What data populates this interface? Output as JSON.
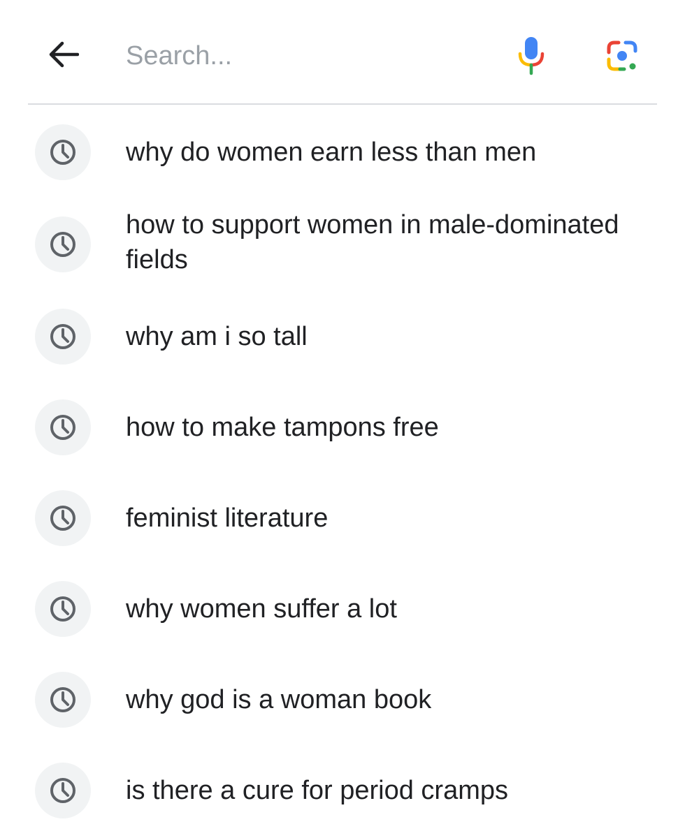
{
  "search": {
    "placeholder": "Search...",
    "value": ""
  },
  "icons": {
    "back": "arrow-back-icon",
    "mic": "microphone-icon",
    "lens": "google-lens-icon",
    "history": "history-clock-icon"
  },
  "colors": {
    "text": "#202124",
    "placeholder": "#9aa0a6",
    "icon_bg": "#f1f3f4",
    "icon": "#5f6368",
    "divider": "#dadce0",
    "google_blue": "#4285f4",
    "google_red": "#ea4335",
    "google_yellow": "#fbbc04",
    "google_green": "#34a853"
  },
  "suggestions": [
    {
      "text": "why do women earn less than men"
    },
    {
      "text": "how to support women in male-dominated fields"
    },
    {
      "text": "why am i so tall"
    },
    {
      "text": "how to make tampons free"
    },
    {
      "text": "feminist literature"
    },
    {
      "text": "why women suffer a lot"
    },
    {
      "text": "why god is a woman book"
    },
    {
      "text": "is there a cure for period cramps"
    }
  ]
}
